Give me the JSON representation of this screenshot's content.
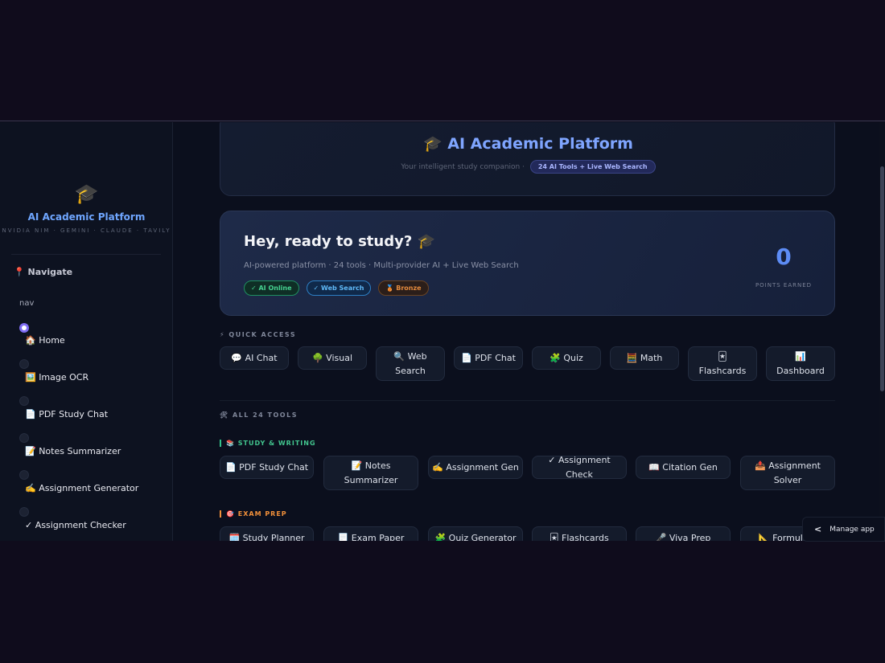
{
  "sidebar": {
    "brand_icon": "🎓",
    "brand_title": "AI Academic Platform",
    "brand_sub": "NVIDIA NIM · GEMINI · CLAUDE · TAVILY",
    "nav_heading": "📍 Navigate",
    "nav_label": "nav",
    "items": [
      {
        "label": "🏠 Home",
        "selected": true
      },
      {
        "label": "🖼️ Image OCR",
        "selected": false
      },
      {
        "label": "📄 PDF Study Chat",
        "selected": false
      },
      {
        "label": "📝 Notes Summarizer",
        "selected": false
      },
      {
        "label": "✍️ Assignment Generator",
        "selected": false
      },
      {
        "label": "✓ Assignment Checker",
        "selected": false
      }
    ]
  },
  "hero": {
    "title": "🎓 AI Academic Platform",
    "subtitle": "Your intelligent study companion ·",
    "pill": "24 AI Tools + Live Web Search"
  },
  "welcome": {
    "title": "Hey, ready to study? 🎓",
    "subtitle": "AI-powered platform · 24 tools · Multi-provider AI + Live Web Search",
    "badges": [
      "✓ AI Online",
      "✓ Web Search",
      "🥉 Bronze"
    ],
    "points": "0",
    "points_label": "POINTS EARNED"
  },
  "quick_access": {
    "heading": "⚡ QUICK ACCESS",
    "buttons": [
      [
        "💬 AI Chat"
      ],
      [
        "🌳 Visual"
      ],
      [
        "🔍 Web",
        "Search"
      ],
      [
        "📄 PDF Chat"
      ],
      [
        "🧩 Quiz"
      ],
      [
        "🧮 Math"
      ],
      [
        "🃏",
        "Flashcards"
      ],
      [
        "📊",
        "Dashboard"
      ]
    ]
  },
  "all_tools": {
    "heading": "🛠 ALL 24 TOOLS",
    "categories": [
      {
        "name": "📚 STUDY & WRITING",
        "tools": [
          [
            "📄 PDF Study Chat"
          ],
          [
            "📝 Notes",
            "Summarizer"
          ],
          [
            "✍️ Assignment Gen"
          ],
          [
            "✓ Assignment Check"
          ],
          [
            "📖 Citation Gen"
          ],
          [
            "📤 Assignment",
            "Solver"
          ]
        ]
      },
      {
        "name": "🎯 EXAM PREP",
        "tools": [
          [
            "🗓️ Study Planner"
          ],
          [
            "📃 Exam Paper"
          ],
          [
            "🧩 Quiz Generator"
          ],
          [
            "🃏 Flashcards"
          ],
          [
            "🎤 Viva Prep"
          ],
          [
            "📐 Formula S"
          ]
        ]
      }
    ]
  },
  "manage_app": "Manage app",
  "colors": {
    "accent": "#7fa5ff",
    "points": "#5d8cf5",
    "green": "#42c58e",
    "orange": "#f1903a",
    "background": "#0b0f1d"
  }
}
